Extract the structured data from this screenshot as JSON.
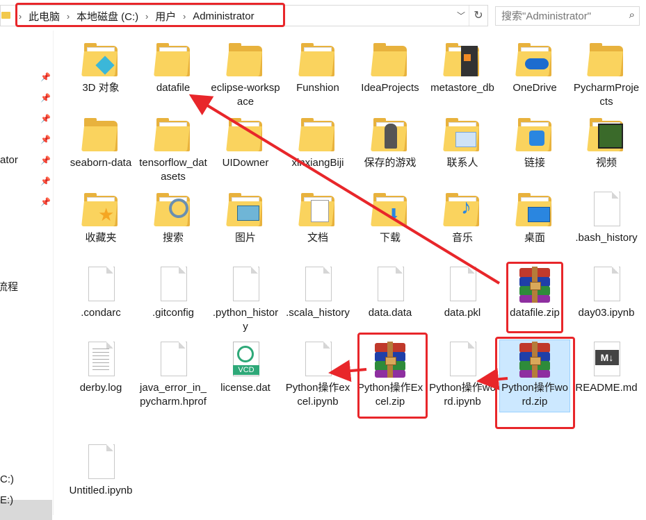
{
  "address": {
    "breadcrumbs": [
      "此电脑",
      "本地磁盘 (C:)",
      "用户",
      "Administrator"
    ]
  },
  "search": {
    "placeholder": "搜索\"Administrator\""
  },
  "nav": {
    "partial_labels": [
      "ator",
      "流程",
      "C:)",
      "E:)"
    ],
    "pins": 7
  },
  "items": [
    {
      "label": "3D 对象",
      "type": "folder",
      "icon": "3d-objects-icon"
    },
    {
      "label": "datafile",
      "type": "folder",
      "icon": "document-folder-icon"
    },
    {
      "label": "eclipse-workspace",
      "type": "folder",
      "icon": "folder-icon"
    },
    {
      "label": "Funshion",
      "type": "folder",
      "icon": "document-folder-icon"
    },
    {
      "label": "IdeaProjects",
      "type": "folder",
      "icon": "folder-icon"
    },
    {
      "label": "metastore_db",
      "type": "folder",
      "icon": "dark-folder-icon"
    },
    {
      "label": "OneDrive",
      "type": "folder",
      "icon": "onedrive-icon"
    },
    {
      "label": "PycharmProjects",
      "type": "folder",
      "icon": "folder-icon"
    },
    {
      "label": "seaborn-data",
      "type": "folder",
      "icon": "folder-icon"
    },
    {
      "label": "tensorflow_datasets",
      "type": "folder",
      "icon": "document-folder-icon"
    },
    {
      "label": "UIDowner",
      "type": "folder",
      "icon": "document-folder-icon"
    },
    {
      "label": "xinxiangBiji",
      "type": "folder",
      "icon": "document-folder-icon"
    },
    {
      "label": "保存的游戏",
      "type": "folder",
      "icon": "saved-games-icon"
    },
    {
      "label": "联系人",
      "type": "folder",
      "icon": "contacts-icon"
    },
    {
      "label": "链接",
      "type": "folder",
      "icon": "links-icon"
    },
    {
      "label": "视频",
      "type": "folder",
      "icon": "videos-icon"
    },
    {
      "label": "收藏夹",
      "type": "folder",
      "icon": "favorites-icon"
    },
    {
      "label": "搜索",
      "type": "folder",
      "icon": "searches-icon"
    },
    {
      "label": "图片",
      "type": "folder",
      "icon": "pictures-icon"
    },
    {
      "label": "文档",
      "type": "folder",
      "icon": "documents-icon"
    },
    {
      "label": "下载",
      "type": "folder",
      "icon": "downloads-icon"
    },
    {
      "label": "音乐",
      "type": "folder",
      "icon": "music-icon"
    },
    {
      "label": "桌面",
      "type": "folder",
      "icon": "desktop-icon"
    },
    {
      "label": ".bash_history",
      "type": "file",
      "icon": "file-icon"
    },
    {
      "label": ".condarc",
      "type": "file",
      "icon": "file-icon"
    },
    {
      "label": ".gitconfig",
      "type": "file",
      "icon": "file-icon"
    },
    {
      "label": ".python_history",
      "type": "file",
      "icon": "file-icon"
    },
    {
      "label": ".scala_history",
      "type": "file",
      "icon": "file-icon"
    },
    {
      "label": "data.data",
      "type": "file",
      "icon": "file-icon"
    },
    {
      "label": "data.pkl",
      "type": "file",
      "icon": "file-icon"
    },
    {
      "label": "datafile.zip",
      "type": "zip",
      "icon": "winrar-archive-icon"
    },
    {
      "label": "day03.ipynb",
      "type": "file",
      "icon": "file-icon"
    },
    {
      "label": "derby.log",
      "type": "file",
      "icon": "text-file-icon"
    },
    {
      "label": "java_error_in_pycharm.hprof",
      "type": "file",
      "icon": "file-icon"
    },
    {
      "label": "license.dat",
      "type": "vcd",
      "icon": "vcd-file-icon",
      "badge": "VCD"
    },
    {
      "label": "Python操作excel.ipynb",
      "type": "file",
      "icon": "file-icon"
    },
    {
      "label": "Python操作Excel.zip",
      "type": "zip",
      "icon": "winrar-archive-icon"
    },
    {
      "label": "Python操作word.ipynb",
      "type": "file",
      "icon": "file-icon"
    },
    {
      "label": "Python操作word.zip",
      "type": "zip",
      "icon": "winrar-archive-icon",
      "selected": true
    },
    {
      "label": "README.md",
      "type": "md",
      "icon": "markdown-file-icon",
      "badge": "M↓"
    },
    {
      "label": "Untitled.ipynb",
      "type": "file",
      "icon": "file-icon"
    }
  ],
  "colors": {
    "annotation_red": "#e8262a",
    "selection_fill": "#cce8ff",
    "folder_yellow": "#fad35e"
  }
}
